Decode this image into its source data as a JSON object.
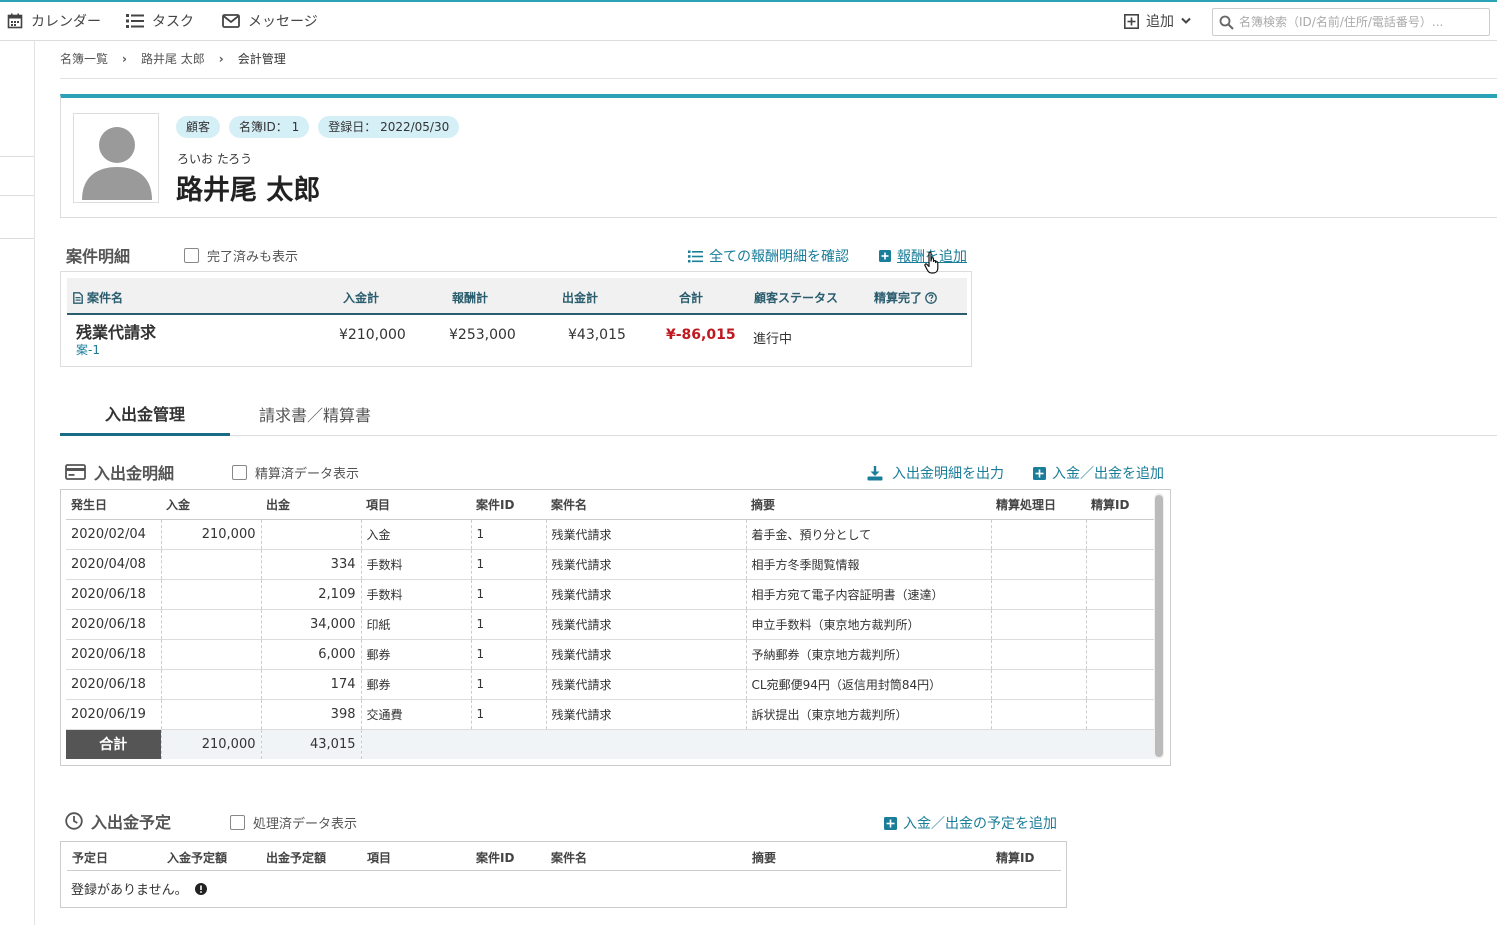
{
  "topbar": {
    "calendar_label": "カレンダー",
    "task_label": "タスク",
    "message_label": "メッセージ",
    "add_label": "追加",
    "search_placeholder": "名簿検索（ID/名前/住所/電話番号）..."
  },
  "breadcrumb": [
    "名簿一覧",
    "路井尾 太郎",
    "会計管理"
  ],
  "profile": {
    "badges": [
      "顧客",
      "名簿ID： 1",
      "登録日： 2022/05/30"
    ],
    "kana": "ろいお たろう",
    "name": "路井尾 太郎"
  },
  "cases": {
    "title": "案件明細",
    "show_completed_label": "完了済みも表示",
    "view_all_link": "全ての報酬明細を確認",
    "add_fee_link": "報酬を追加",
    "headers": [
      "案件名",
      "入金計",
      "報酬計",
      "出金計",
      "合計",
      "顧客ステータス",
      "精算完了"
    ],
    "row": {
      "name": "残業代請求",
      "code": "案-1",
      "deposit_total": "¥210,000",
      "fee_total": "¥253,000",
      "withdraw_total": "¥43,015",
      "sum": "¥-86,015",
      "status": "進行中"
    }
  },
  "tabs": [
    "入出金管理",
    "請求書／精算書"
  ],
  "ledger": {
    "title": "入出金明細",
    "show_settled_label": "精算済データ表示",
    "export_link": "入出金明細を出力",
    "add_link": "入金／出金を追加",
    "headers": [
      "発生日",
      "入金",
      "出金",
      "項目",
      "案件ID",
      "案件名",
      "摘要",
      "精算処理日",
      "精算ID"
    ],
    "rows": [
      [
        "2020/02/04",
        "210,000",
        "",
        "入金",
        "1",
        "残業代請求",
        "着手金、預り分として",
        "",
        ""
      ],
      [
        "2020/04/08",
        "",
        "334",
        "手数料",
        "1",
        "残業代請求",
        "相手方冬季閲覧情報",
        "",
        ""
      ],
      [
        "2020/06/18",
        "",
        "2,109",
        "手数料",
        "1",
        "残業代請求",
        "相手方宛て電子内容証明書（速達）",
        "",
        ""
      ],
      [
        "2020/06/18",
        "",
        "34,000",
        "印紙",
        "1",
        "残業代請求",
        "申立手数料（東京地方裁判所）",
        "",
        ""
      ],
      [
        "2020/06/18",
        "",
        "6,000",
        "郵券",
        "1",
        "残業代請求",
        "予納郵券（東京地方裁判所）",
        "",
        ""
      ],
      [
        "2020/06/18",
        "",
        "174",
        "郵券",
        "1",
        "残業代請求",
        "CL宛郵便94円（返信用封筒84円）",
        "",
        ""
      ],
      [
        "2020/06/19",
        "",
        "398",
        "交通費",
        "1",
        "残業代請求",
        "訴状提出（東京地方裁判所）",
        "",
        ""
      ]
    ],
    "total_label": "合計",
    "total_deposit": "210,000",
    "total_withdraw": "43,015"
  },
  "schedule": {
    "title": "入出金予定",
    "show_processed_label": "処理済データ表示",
    "add_link": "入金／出金の予定を追加",
    "headers": [
      "予定日",
      "入金予定額",
      "出金予定額",
      "項目",
      "案件ID",
      "案件名",
      "摘要",
      "精算ID"
    ],
    "empty_text": "登録がありません。"
  },
  "colors": {
    "accent": "#2aa3b8",
    "link": "#1a7d9a",
    "negative": "#c0181f",
    "badge_bg": "#d5eff7"
  }
}
